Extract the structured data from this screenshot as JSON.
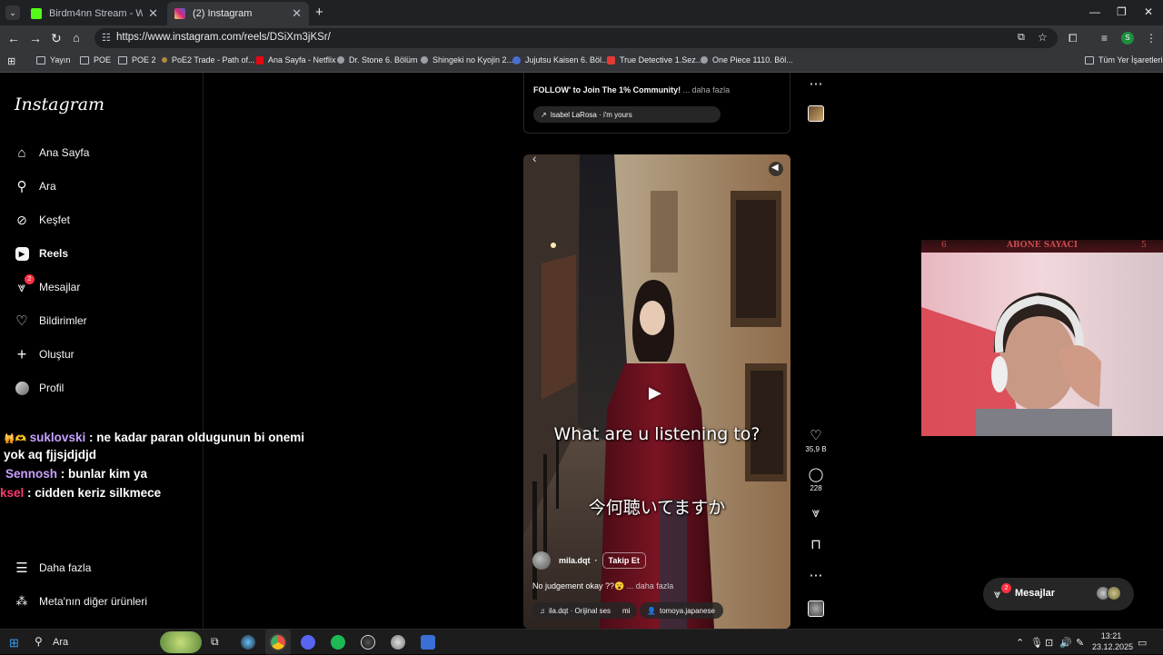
{
  "browser": {
    "tabs": [
      {
        "title": "Birdm4nn Stream - Watch Live",
        "active": false,
        "favicon_color": "#53fc18"
      },
      {
        "title": "(2) Instagram",
        "active": true,
        "favicon_color": "#e1306c"
      }
    ],
    "new_tab_symbol": "+",
    "url": "https://www.instagram.com/reels/DSiXm3jKSr/",
    "profile_initial": "S",
    "bookmarks": [
      "Yayın",
      "POE",
      "POE 2",
      "PoE2 Trade - Path of...",
      "Ana Sayfa - Netflix",
      "Dr. Stone 6. Bölüm",
      "Shingeki no Kyojin 2...",
      "Jujutsu Kaisen 6. Böl...",
      "True Detective 1.Sez...",
      "One Piece 1110. Böl..."
    ],
    "all_bookmarks": "Tüm Yer İşaretleri"
  },
  "instagram": {
    "logo": "Instagram",
    "nav": [
      {
        "label": "Ana Sayfa",
        "icon": "home-icon"
      },
      {
        "label": "Ara",
        "icon": "search-icon"
      },
      {
        "label": "Keşfet",
        "icon": "compass-icon"
      },
      {
        "label": "Reels",
        "icon": "reels-icon"
      },
      {
        "label": "Mesajlar",
        "icon": "messenger-icon",
        "badge": "2"
      },
      {
        "label": "Bildirimler",
        "icon": "heart-icon"
      },
      {
        "label": "Oluştur",
        "icon": "plus-icon"
      },
      {
        "label": "Profil",
        "icon": "avatar-icon"
      }
    ],
    "more": "Daha fazla",
    "meta": "Meta'nın diğer ürünleri",
    "prev_post": {
      "caption": "FOLLOW' to Join The 1% Community!",
      "more": "... daha fazla",
      "audio": "Isabel LaRosa · i'm yours"
    },
    "reel": {
      "subtitle_en": "What are u listening to?",
      "subtitle_jp": "今何聴いてますか",
      "username": "mila.dqt",
      "follow": "Takip Et",
      "caption": "No judgement okay ??😮",
      "more": "... daha fazla",
      "audio": "ila.dqt · Orijinal ses",
      "audio_extra": "mi",
      "tagged": "tomoya.japanese",
      "likes": "35,9 B",
      "comments": "228"
    },
    "messages_widget": {
      "label": "Mesajlar",
      "badge": "2"
    }
  },
  "chat": [
    {
      "user": "suklovski",
      "user_color": "#c9a0ff",
      "text": ": ne kadar paran oldugunun bi onemi",
      "badges": "🙀🫶"
    },
    {
      "user": "",
      "user_color": "#ffffff",
      "text": "yok aq fjjsjdjdjd",
      "badges": ""
    },
    {
      "user": "Sennosh",
      "user_color": "#c9a0ff",
      "text": ": bunlar kim ya",
      "badges": ""
    },
    {
      "user": "ksel",
      "user_color": "#ff3b6b",
      "text": ": cidden keriz silkmece",
      "badges": ""
    }
  ],
  "webcam": {
    "title": "ABONE SAYACI",
    "left_num": "6",
    "right_num": "5"
  },
  "taskbar": {
    "search": "Ara",
    "time": "13:21",
    "date": "23.12.2025"
  }
}
